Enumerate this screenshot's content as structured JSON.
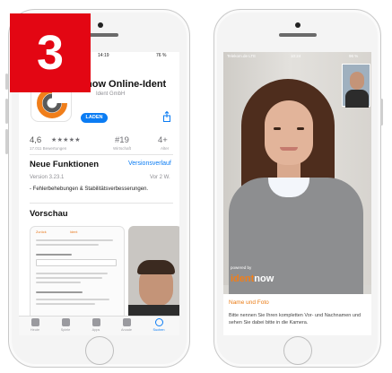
{
  "step_badge": {
    "number": "3",
    "color": "#e30613"
  },
  "left_phone": {
    "status_bar": {
      "time": "14:19",
      "battery": "76 %"
    },
    "app": {
      "title": "now Online-Ident",
      "developer": "Ident GmbH",
      "get_label": "LADEN",
      "rating_value": "4,6",
      "rating_stars": "★★★★★",
      "rating_count": "17.011 Bewertungen",
      "rank": "#19",
      "rank_category": "Wirtschaft",
      "age": "4+",
      "age_label": "Alter"
    },
    "whats_new": {
      "title": "Neue Funktionen",
      "history_link": "Versionsverlauf",
      "version": "Version 3.23.1",
      "age": "Vor 2 W.",
      "notes": "- Fehlerbehebungen & Stabilitätsverbesserungen."
    },
    "preview": {
      "title": "Vorschau",
      "back_label": "Zurück",
      "screen_head": "Ident"
    },
    "tabs": [
      {
        "label": "Heute",
        "icon": "today-icon"
      },
      {
        "label": "Spiele",
        "icon": "games-icon"
      },
      {
        "label": "Apps",
        "icon": "apps-icon"
      },
      {
        "label": "Arcade",
        "icon": "arcade-icon"
      },
      {
        "label": "Suchen",
        "icon": "search-icon",
        "active": true
      }
    ]
  },
  "right_phone": {
    "status_bar": {
      "carrier": "Telekom.de LTE",
      "time": "10:24",
      "battery": "96 %"
    },
    "powered_by": "powered by",
    "logo_prefix": "ident",
    "logo_suffix": "now",
    "info": {
      "title": "Name und Foto",
      "text": "Bitte nennen Sie Ihren kompletten Vor- und Nachnamen und sehen Sie dabei bitte in die Kamera."
    }
  },
  "colors": {
    "accent_blue": "#0b7cf3",
    "accent_orange": "#ea7b14"
  }
}
